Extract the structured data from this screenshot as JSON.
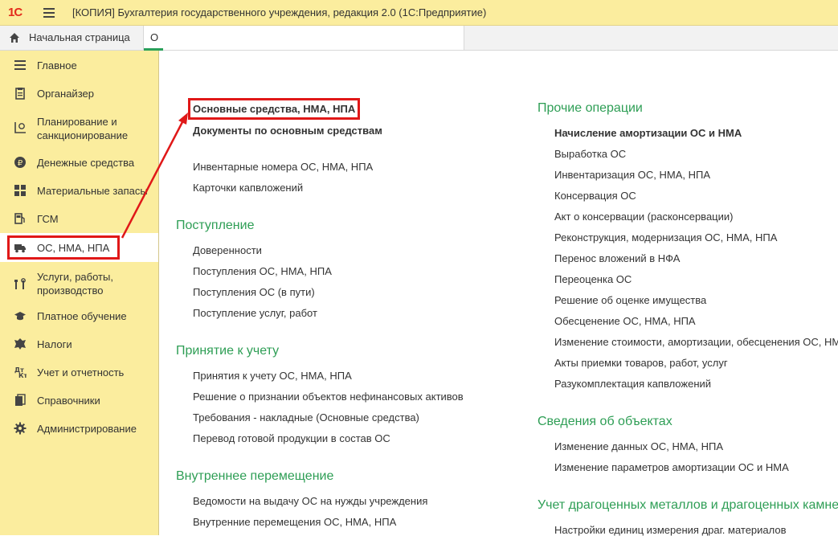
{
  "titlebar": {
    "logo": "1С",
    "title": "[КОПИЯ] Бухгалтерия государственного учреждения, редакция 2.0  (1С:Предприятие)"
  },
  "tabs": {
    "home": "Начальная страница",
    "active": "О",
    "accent_color": "#2aa05a"
  },
  "sidebar": {
    "items": [
      {
        "label": "Главное",
        "icon": "menu-lines-icon"
      },
      {
        "label": "Органайзер",
        "icon": "clipboard-icon"
      },
      {
        "label": "Планирование и\nсанкционирование",
        "icon": "planning-icon"
      },
      {
        "label": "Денежные средства",
        "icon": "ruble-coin-icon"
      },
      {
        "label": "Материальные запасы",
        "icon": "grid-icon"
      },
      {
        "label": "ГСМ",
        "icon": "fuel-icon"
      },
      {
        "label": "ОС, НМА, НПА",
        "icon": "truck-icon"
      },
      {
        "label": "Услуги, работы,\nпроизводство",
        "icon": "tools-icon"
      },
      {
        "label": "Платное обучение",
        "icon": "graduation-cap-icon"
      },
      {
        "label": "Налоги",
        "icon": "emblem-icon"
      },
      {
        "label": "Учет и отчетность",
        "icon": "dt-kt-icon"
      },
      {
        "label": "Справочники",
        "icon": "books-icon"
      },
      {
        "label": "Администрирование",
        "icon": "gear-icon"
      }
    ]
  },
  "left_column": {
    "top_links": [
      "Основные средства, НМА, НПА",
      "Документы по основным средствам"
    ],
    "extra_links": [
      "Инвентарные номера ОС, НМА, НПА",
      "Карточки капвложений"
    ],
    "sections": [
      {
        "title": "Поступление",
        "items": [
          "Доверенности",
          "Поступления ОС, НМА, НПА",
          "Поступления ОС (в пути)",
          "Поступление услуг, работ"
        ]
      },
      {
        "title": "Принятие к учету",
        "items": [
          "Принятия к учету ОС, НМА, НПА",
          "Решение о признании объектов нефинансовых активов",
          "Требования - накладные (Основные средства)",
          "Перевод готовой продукции в состав ОС"
        ]
      },
      {
        "title": "Внутреннее перемещение",
        "items": [
          "Ведомости на выдачу ОС на нужды учреждения",
          "Внутренние перемещения ОС, НМА, НПА"
        ]
      }
    ]
  },
  "right_column": {
    "sections": [
      {
        "title": "Прочие операции",
        "items": [
          "Начисление амортизации ОС и НМА",
          "Выработка ОС",
          "Инвентаризация ОС, НМА, НПА",
          "Консервация ОС",
          "Акт о консервации (расконсервации)",
          "Реконструкция, модернизация ОС, НМА, НПА",
          "Перенос вложений в НФА",
          "Переоценка ОС",
          "Решение об оценке имущества",
          "Обесценение ОС, НМА, НПА",
          "Изменение стоимости, амортизации, обесценения ОС, НМА",
          "Акты приемки товаров, работ, услуг",
          "Разукомплектация капвложений"
        ]
      },
      {
        "title": "Сведения об объектах",
        "items": [
          "Изменение данных ОС, НМА, НПА",
          "Изменение параметров амортизации ОС и НМА"
        ]
      },
      {
        "title": "Учет драгоценных металлов и драгоценных камней",
        "items": [
          "Настройки единиц измерения драг. материалов"
        ]
      }
    ]
  },
  "colors": {
    "sidebar_bg": "#fbed9e",
    "section_title": "#2e9e55",
    "highlight": "#e01818"
  }
}
